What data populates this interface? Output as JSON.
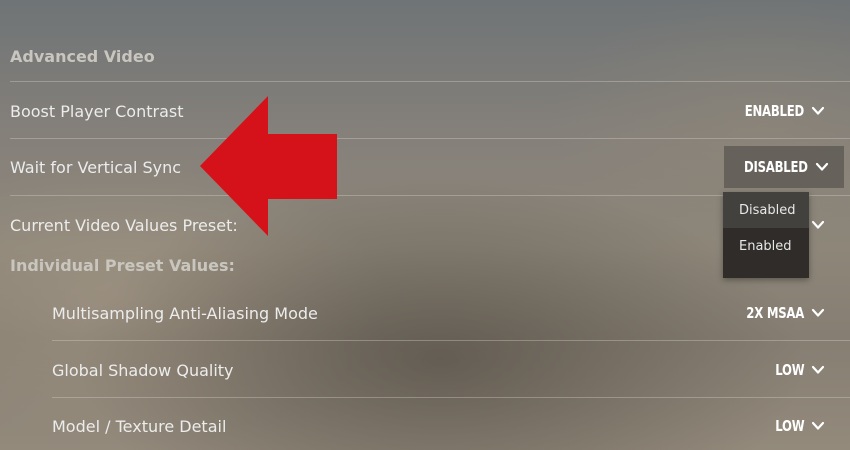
{
  "section": {
    "title": "Advanced Video",
    "preset_subheader": "Individual Preset Values:"
  },
  "settings": [
    {
      "label": "Boost Player Contrast",
      "value": "ENABLED"
    },
    {
      "label": "Wait for Vertical Sync",
      "value": "DISABLED",
      "open": true
    },
    {
      "label": "Current Video Values Preset:",
      "value": ""
    },
    {
      "label": "Multisampling Anti-Aliasing Mode",
      "value": "2X MSAA"
    },
    {
      "label": "Global Shadow Quality",
      "value": "LOW"
    },
    {
      "label": "Model / Texture Detail",
      "value": "LOW"
    }
  ],
  "dropdown": {
    "options": [
      "Disabled",
      "Enabled"
    ],
    "selected": "Disabled"
  },
  "icons": {
    "chevron": "chevron-down-icon",
    "annotation": "red-arrow-icon"
  },
  "colors": {
    "annotation_arrow": "#d5121a",
    "value_text": "#ffffff"
  }
}
